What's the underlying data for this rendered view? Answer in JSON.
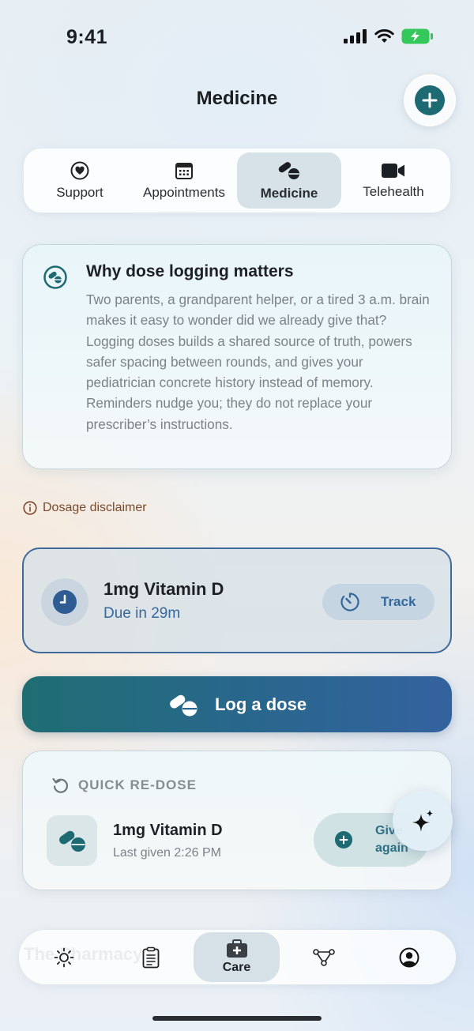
{
  "status_bar": {
    "time": "9:41"
  },
  "header": {
    "title": "Medicine"
  },
  "tabs": [
    {
      "label": "Support",
      "icon": "heart-circle-icon"
    },
    {
      "label": "Appointments",
      "icon": "calendar-icon"
    },
    {
      "label": "Medicine",
      "icon": "pills-icon",
      "active": true
    },
    {
      "label": "Telehealth",
      "icon": "video-camera-icon"
    }
  ],
  "info_card": {
    "title": "Why dose logging matters",
    "body": "Two parents, a grandparent helper, or a tired 3 a.m. brain makes it easy to wonder did we already give that? Logging doses builds a shared source of truth, powers safer spacing between rounds, and gives your pediatrician concrete history instead of memory. Reminders nudge you; they do not replace your prescriber’s instructions."
  },
  "disclaimer": {
    "label": "Dosage disclaimer"
  },
  "due_card": {
    "medicine": "1mg Vitamin D",
    "due": "Due in 29m",
    "track_label": "Track"
  },
  "log_button": {
    "label": "Log a dose"
  },
  "quick_redose": {
    "heading": "QUICK RE-DOSE",
    "medicine": "1mg Vitamin D",
    "last_given": "Last given 2:26 PM",
    "give_again_label_1": "Give",
    "give_again_label_2": "again"
  },
  "bottom_nav": {
    "ghost_text": "The Pharmacy G",
    "items": [
      {
        "icon": "sun-icon"
      },
      {
        "icon": "clipboard-icon"
      },
      {
        "icon": "first-aid-kit-icon",
        "label": "Care",
        "active": true
      },
      {
        "icon": "network-icon"
      },
      {
        "icon": "profile-icon"
      }
    ]
  },
  "colors": {
    "teal": "#1e6a72",
    "blue": "#35689b",
    "disclaimer_brown": "#7a4a2c",
    "battery_green": "#34c759"
  }
}
